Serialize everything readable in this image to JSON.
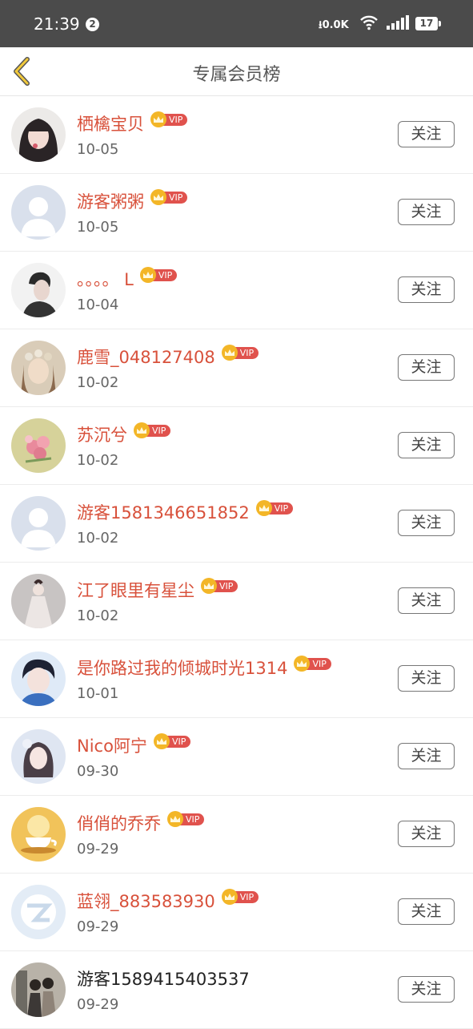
{
  "status_bar": {
    "time": "21:39",
    "notification_count": "2",
    "net_speed": "0.0K",
    "battery": "17"
  },
  "header": {
    "title": "专属会员榜"
  },
  "vip_label": "VIP",
  "follow_label": "关注",
  "members": [
    {
      "name": "栖檎宝贝",
      "date": "10-05",
      "vip": true,
      "avatar": "photo-girl-dark"
    },
    {
      "name": "游客粥粥",
      "date": "10-05",
      "vip": true,
      "avatar": "default"
    },
    {
      "name": "。。。。 L",
      "date": "10-04",
      "vip": true,
      "avatar": "photo-boy"
    },
    {
      "name": "鹿雪_048127408",
      "date": "10-02",
      "vip": true,
      "avatar": "photo-flower-crown"
    },
    {
      "name": "苏沉兮",
      "date": "10-02",
      "vip": true,
      "avatar": "photo-roses"
    },
    {
      "name": "游客1581346651852",
      "date": "10-02",
      "vip": true,
      "avatar": "default"
    },
    {
      "name": "江了眼里有星尘",
      "date": "10-02",
      "vip": true,
      "avatar": "photo-dress"
    },
    {
      "name": "是你路过我的倾城时光1314",
      "date": "10-01",
      "vip": true,
      "avatar": "photo-boy-blue"
    },
    {
      "name": "Nico阿宁",
      "date": "09-30",
      "vip": true,
      "avatar": "photo-girl-light"
    },
    {
      "name": "俏俏的乔乔",
      "date": "09-29",
      "vip": true,
      "avatar": "photo-teacup"
    },
    {
      "name": "蓝翎_883583930",
      "date": "09-29",
      "vip": true,
      "avatar": "qq-logo"
    },
    {
      "name": "游客1589415403537",
      "date": "09-29",
      "vip": false,
      "avatar": "photo-couple"
    }
  ]
}
